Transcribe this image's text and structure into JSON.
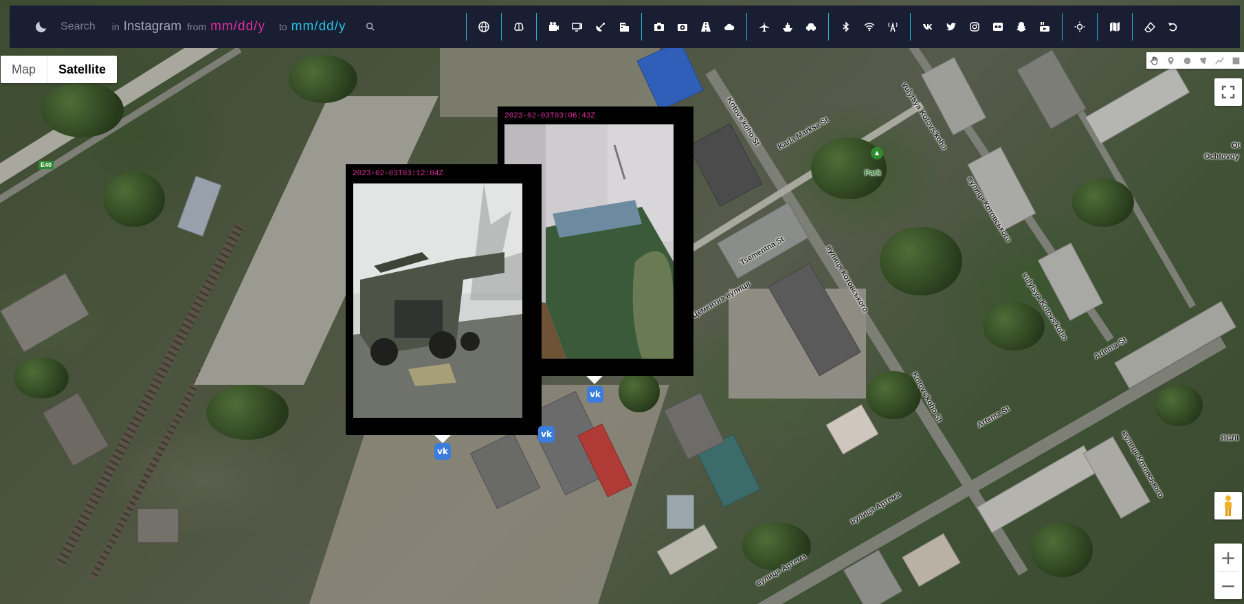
{
  "toolbar": {
    "search_placeholder": "Search",
    "in_label": "in",
    "source": "Instagram",
    "from_label": "from",
    "from_date": "mm/dd/y",
    "to_label": "to",
    "to_date": "mm/dd/y",
    "groups": [
      [
        "globe-icon",
        "brain-icon"
      ],
      [
        "cinema-icon",
        "tv-icon",
        "satellite-dish-icon",
        "building-icon"
      ],
      [
        "camera-icon",
        "camera-alt-icon",
        "road-icon",
        "cloud-icon"
      ],
      [
        "plane-icon",
        "ship-icon",
        "car-icon"
      ],
      [
        "bluetooth-icon",
        "wifi-icon",
        "tower-icon"
      ],
      [
        "vk-icon",
        "twitter-icon",
        "instagram-icon",
        "flickr-icon",
        "snapchat-icon",
        "youtube-icon"
      ],
      [
        "sun-icon"
      ],
      [
        "map-icon"
      ],
      [
        "eraser-icon",
        "undo-icon"
      ]
    ]
  },
  "map_type": {
    "map_label": "Map",
    "satellite_label": "Satellite",
    "selected": "Satellite"
  },
  "popups": [
    {
      "timestamp": "2023-02-03T03:06:43Z",
      "platform": "vk",
      "photo": "room-with-green-bed"
    },
    {
      "timestamp": "2023-02-03T03:12:04Z",
      "platform": "vk",
      "photo": "military-truck"
    }
  ],
  "map_labels": {
    "e40": "E40",
    "kotovskoho_st": "Kotovs'koho St",
    "karla_marksa": "Karla Marksa St",
    "vulytsya_kotovskoho_1": "vulytsya Kotovs'koho",
    "vulytsya_kotovskoho_2": "вулиця Котовського",
    "tsementna": "Tsementna St",
    "tsementna_ua": "Цементна вулиця",
    "kotovskoho_st_2": "Kotovs'koho St",
    "artema_st": "Artema St",
    "artema_st_2": "Artema St",
    "vulytsya_artema": "вулиця Артема",
    "vulytsya_artema_2": "вулиця Артема",
    "vulytsya_kotovskoho_3": "вулиця Котовського",
    "vulytsya_kotovskoho_4": "vulytsya Kotovs'koho",
    "park": "Park",
    "yasli": "ЯСЛІ",
    "ochtovoy": "Ochtovoy",
    "ot": "Ot"
  },
  "colors": {
    "toolbar_bg": "#1a1e33",
    "from_date": "#e02fa1",
    "to_date": "#25c4e0",
    "separator": "#25b8d8",
    "vk_marker": "#3b7ddd"
  }
}
